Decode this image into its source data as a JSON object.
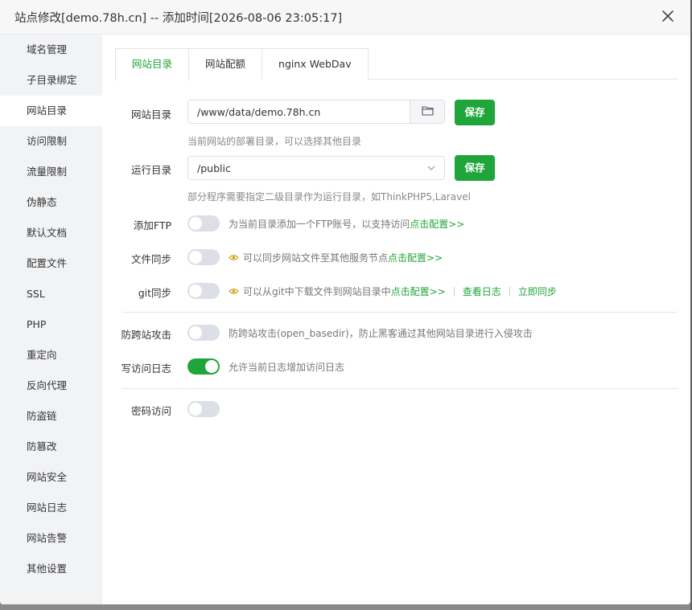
{
  "window": {
    "title": "站点修改[demo.78h.cn] -- 添加时间[2026-08-06 23:05:17]"
  },
  "sidebar": {
    "items": [
      {
        "label": "域名管理"
      },
      {
        "label": "子目录绑定"
      },
      {
        "label": "网站目录"
      },
      {
        "label": "访问限制"
      },
      {
        "label": "流量限制"
      },
      {
        "label": "伪静态"
      },
      {
        "label": "默认文档"
      },
      {
        "label": "配置文件"
      },
      {
        "label": "SSL"
      },
      {
        "label": "PHP"
      },
      {
        "label": "重定向"
      },
      {
        "label": "反向代理"
      },
      {
        "label": "防盗链"
      },
      {
        "label": "防篡改"
      },
      {
        "label": "网站安全"
      },
      {
        "label": "网站日志"
      },
      {
        "label": "网站告警"
      },
      {
        "label": "其他设置"
      }
    ],
    "active_index": 2
  },
  "tabs": [
    {
      "label": "网站目录"
    },
    {
      "label": "网站配额"
    },
    {
      "label": "nginx WebDav"
    }
  ],
  "form": {
    "site_dir": {
      "label": "网站目录",
      "value": "/www/data/demo.78h.cn",
      "save": "保存",
      "hint": "当前网站的部署目录，可以选择其他目录"
    },
    "run_dir": {
      "label": "运行目录",
      "value": "/public",
      "save": "保存",
      "hint": "部分程序需要指定二级目录作为运行目录，如ThinkPHP5,Laravel"
    },
    "ftp": {
      "label": "添加FTP",
      "enabled": false,
      "desc": "为当前目录添加一个FTP账号，以支持访问",
      "link": "点击配置>>"
    },
    "file_sync": {
      "label": "文件同步",
      "enabled": false,
      "desc": "可以同步网站文件至其他服务节点",
      "link": "点击配置>>"
    },
    "git_sync": {
      "label": "git同步",
      "enabled": false,
      "desc": "可以从git中下载文件到网站目录中",
      "link": "点击配置>>",
      "link_logs": "查看日志",
      "link_sync": "立即同步"
    },
    "cross_site": {
      "label": "防跨站攻击",
      "enabled": false,
      "desc": "防跨站攻击(open_basedir)，防止黑客通过其他网站目录进行入侵攻击"
    },
    "access_log": {
      "label": "写访问日志",
      "enabled": true,
      "desc": "允许当前日志增加访问日志"
    },
    "password": {
      "label": "密码访问",
      "enabled": false
    }
  },
  "colors": {
    "accent": "#20a53a",
    "warning_icon": "#d4a017"
  }
}
